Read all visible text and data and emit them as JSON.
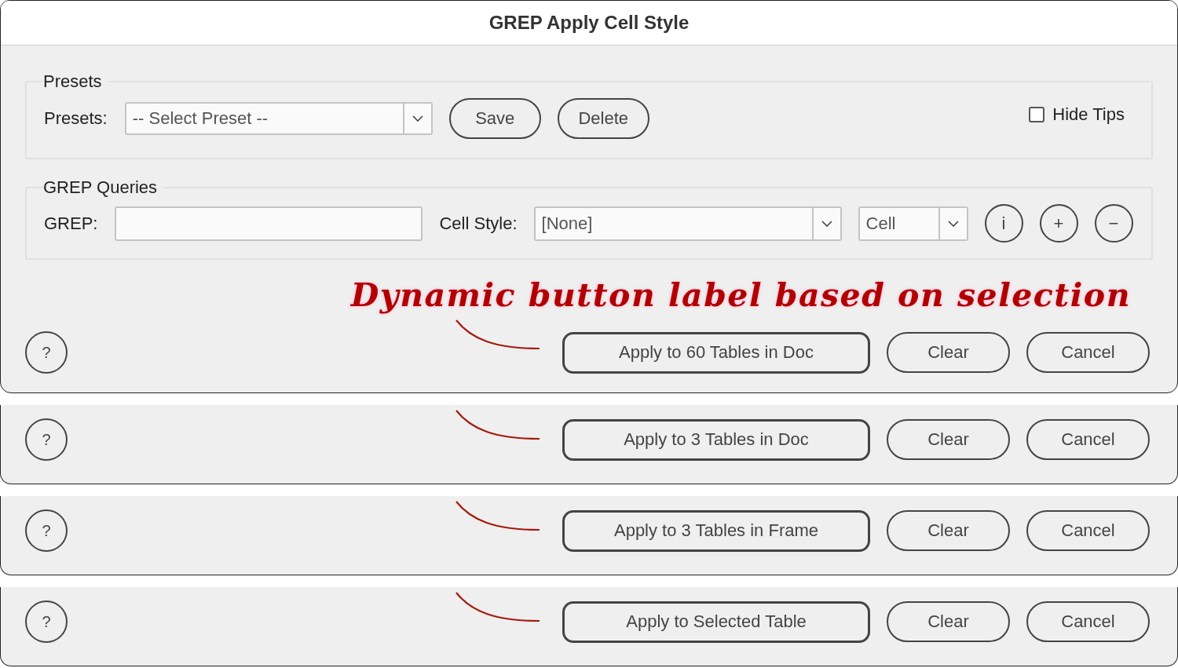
{
  "window": {
    "title": "GREP Apply Cell Style"
  },
  "presets_group": {
    "legend": "Presets",
    "label": "Presets:",
    "dropdown": {
      "value": "-- Select Preset --"
    },
    "buttons": [
      "Save",
      "Delete"
    ],
    "hide_tips": {
      "label": "Hide Tips",
      "checked": false
    }
  },
  "grep_group": {
    "legend": "GREP Queries",
    "grep_label": "GREP:",
    "style_label": "Cell Style:",
    "style_dropdown": {
      "value": "[None]"
    },
    "scope_dropdown": {
      "value": "Cell"
    },
    "icon_buttons": [
      "i",
      "+",
      "−"
    ]
  },
  "annotation": {
    "text": "Dynamic button label based on selection"
  },
  "button_rows": [
    {
      "help": "?",
      "apply": "Apply to 60 Tables in Doc",
      "clear": "Clear",
      "cancel": "Cancel"
    },
    {
      "help": "?",
      "apply": "Apply to 3 Tables in Doc",
      "clear": "Clear",
      "cancel": "Cancel"
    },
    {
      "help": "?",
      "apply": "Apply to 3 Tables in Frame",
      "clear": "Clear",
      "cancel": "Cancel"
    },
    {
      "help": "?",
      "apply": "Apply to Selected Table",
      "clear": "Clear",
      "cancel": "Cancel"
    }
  ]
}
